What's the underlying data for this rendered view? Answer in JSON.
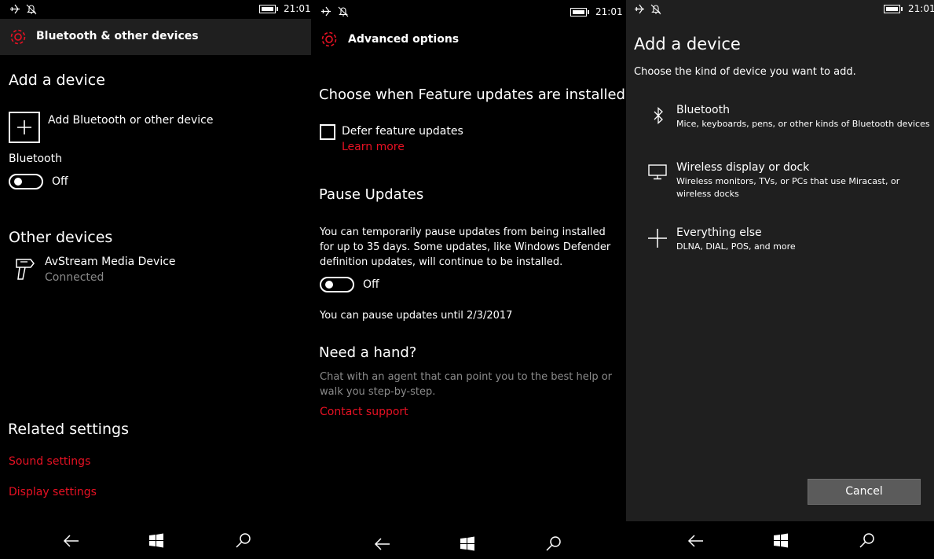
{
  "status_time": "21:01",
  "panel1": {
    "title": "Bluetooth & other devices",
    "add_device_heading": "Add a device",
    "add_device_button": "Add Bluetooth or other device",
    "bluetooth_label": "Bluetooth",
    "bluetooth_toggle_state": "Off",
    "other_devices_heading": "Other devices",
    "device_name": "AvStream Media Device",
    "device_status": "Connected",
    "related_heading": "Related settings",
    "sound_settings": "Sound settings",
    "display_settings": "Display settings"
  },
  "panel2": {
    "title": "Advanced options",
    "feature_updates_heading": "Choose when Feature updates are installed",
    "defer_checkbox_label": "Defer feature updates",
    "learn_more": "Learn more",
    "pause_heading": "Pause Updates",
    "pause_desc_line1": "You can temporarily pause updates from being installed",
    "pause_desc_line2": "for up to 35 days. Some updates, like Windows Defender",
    "pause_desc_line3": "definition updates, will continue to be installed.",
    "pause_toggle_state": "Off",
    "pause_until": "You can pause updates until 2/3/2017",
    "help_heading": "Need a hand?",
    "help_desc_line1": "Chat with an agent that can point you to the best help or",
    "help_desc_line2": "walk you step-by-step.",
    "contact_support": "Contact support"
  },
  "panel3": {
    "heading": "Add a device",
    "subheading": "Choose the kind of device you want to add.",
    "options": [
      {
        "title": "Bluetooth",
        "desc_line1": "Mice, keyboards, pens, or other kinds of Bluetooth devices",
        "desc_line2": "",
        "icon": "bluetooth-icon"
      },
      {
        "title": "Wireless display or dock",
        "desc_line1": "Wireless monitors, TVs, or PCs that use Miracast, or",
        "desc_line2": "wireless docks",
        "icon": "monitor-icon"
      },
      {
        "title": "Everything else",
        "desc_line1": "DLNA, DIAL, POS, and more",
        "desc_line2": "",
        "icon": "plus-icon"
      }
    ],
    "cancel_button": "Cancel"
  },
  "colors": {
    "accent_red": "#e81123",
    "title_bar": "#1f1f1f",
    "background": "#000000"
  }
}
